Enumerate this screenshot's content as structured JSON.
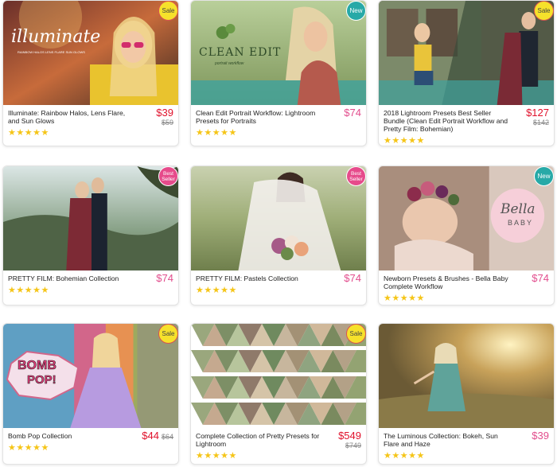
{
  "products": [
    {
      "title": "Illuminate: Rainbow Halos, Lens Flare, and Sun Glows",
      "price": "$39",
      "old_price": "$59",
      "badge": "Sale",
      "overlay": "illuminate",
      "overlay_sub": "RAINBOW HALOS  LENS FLARE  SUN GLOWS",
      "stars": "★★★★★"
    },
    {
      "title": "Clean Edit Portrait Workflow: Lightroom Presets for Portraits",
      "price": "$74",
      "old_price": "",
      "badge": "New",
      "overlay": "CLEAN EDIT",
      "overlay_sub": "portrait workflow",
      "stars": "★★★★★"
    },
    {
      "title": "2018 Lightroom Presets Best Seller Bundle (Clean Edit Portrait Workflow and Pretty Film: Bohemian)",
      "price": "$127",
      "old_price": "$142",
      "badge": "Sale",
      "stars": "★★★★★"
    },
    {
      "title": "PRETTY FILM: Bohemian Collection",
      "price": "$74",
      "old_price": "",
      "badge": "Best Seller",
      "stars": "★★★★★"
    },
    {
      "title": "PRETTY FILM: Pastels Collection",
      "price": "$74",
      "old_price": "",
      "badge": "Best Seller",
      "stars": "★★★★★"
    },
    {
      "title": "Newborn Presets & Brushes - Bella Baby Complete Workflow",
      "price": "$74",
      "old_price": "",
      "badge": "New",
      "overlay": "Bella",
      "overlay_sub": "BABY",
      "stars": "★★★★★"
    },
    {
      "title": "Bomb Pop Collection",
      "price": "$44",
      "old_price": "$64",
      "badge": "Sale",
      "overlay": "BOMB",
      "overlay_sub": "POP!",
      "stars": "★★★★★"
    },
    {
      "title": "Complete Collection of Pretty Presets for Lightroom",
      "price": "$549",
      "old_price": "$749",
      "badge": "Sale",
      "stars": "★★★★★"
    },
    {
      "title": "The Luminous Collection: Bokeh, Sun Flare and Haze",
      "price": "$39",
      "old_price": "",
      "badge": "",
      "stars": "★★★★★"
    }
  ],
  "colors": {
    "price_regular": "#e24d8d",
    "price_sale": "#e0112b",
    "badge_sale": "#f6e12b",
    "badge_new": "#27a9a7",
    "badge_best": "#e64b8b",
    "stars": "#f5c518"
  }
}
